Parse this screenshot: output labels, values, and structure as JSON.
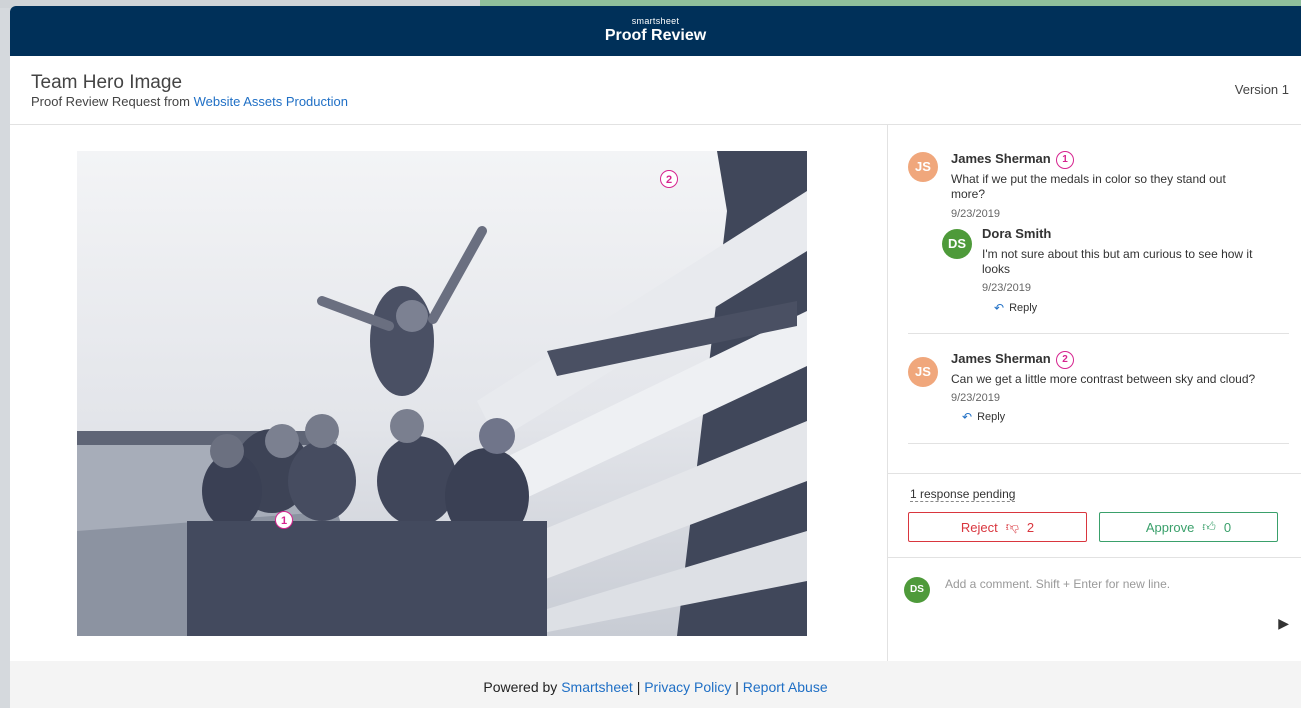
{
  "topbar": {
    "brand": "smartsheet",
    "title": "Proof Review"
  },
  "header": {
    "doc_title": "Team Hero Image",
    "request_prefix": "Proof Review Request from",
    "request_source": "Website Assets Production",
    "version": "Version 1"
  },
  "proof": {
    "pins": [
      "1",
      "2"
    ]
  },
  "comments": [
    {
      "initials": "JS",
      "author": "James Sherman",
      "pin": "1",
      "text": "What if we put the medals in color so they stand out more?",
      "date": "9/23/2019",
      "replies": [
        {
          "initials": "DS",
          "author": "Dora Smith",
          "text": "I'm not sure about this but am curious to see how it looks",
          "date": "9/23/2019",
          "reply_label": "Reply"
        }
      ]
    },
    {
      "initials": "JS",
      "author": "James Sherman",
      "pin": "2",
      "text": "Can we get a little more contrast between sky and cloud?",
      "date": "9/23/2019",
      "reply_label": "Reply"
    }
  ],
  "decision": {
    "pending": "1 response pending",
    "reject_label": "Reject",
    "reject_count": "2",
    "approve_label": "Approve",
    "approve_count": "0"
  },
  "composer": {
    "initials": "DS",
    "placeholder": "Add a comment. Shift + Enter for new line."
  },
  "footer": {
    "powered_by": "Powered by",
    "smartsheet": "Smartsheet",
    "sep": "|",
    "privacy": "Privacy Policy",
    "report": "Report Abuse"
  },
  "colors": {
    "topbar": "#003059",
    "pin": "#d6248f",
    "reject": "#d9363e",
    "approve": "#3aa06b",
    "link": "#1f6fc5"
  }
}
